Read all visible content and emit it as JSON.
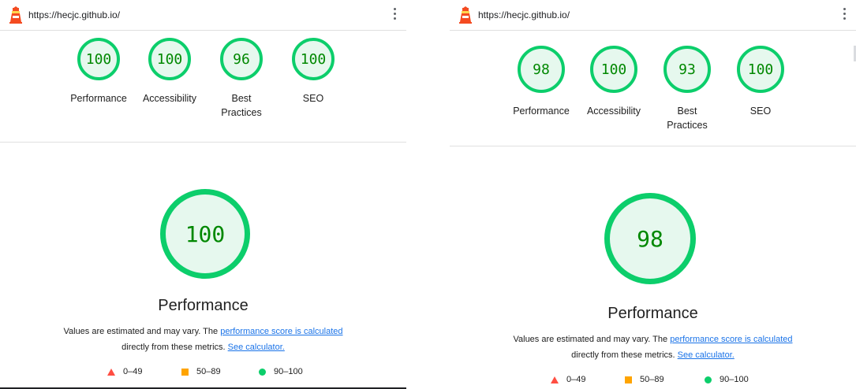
{
  "colors": {
    "pass": "#0cce6b",
    "pass_text": "#008800",
    "average": "#ffa400",
    "fail": "#ff4e42",
    "link": "#1a73e8"
  },
  "reports": [
    {
      "url": "https://hecjc.github.io/",
      "scores": [
        {
          "value": "100",
          "label": "Performance"
        },
        {
          "value": "100",
          "label": "Accessibility"
        },
        {
          "value": "96",
          "label": "Best Practices"
        },
        {
          "value": "100",
          "label": "SEO"
        }
      ],
      "main_score": "100",
      "main_title": "Performance",
      "desc_prefix": "Values are estimated and may vary. The ",
      "desc_link1": "performance score is calculated",
      "desc_middle": "directly from these metrics. ",
      "desc_link2": "See calculator.",
      "legend": [
        {
          "icon": "fail-triangle-icon",
          "range": "0–49"
        },
        {
          "icon": "average-square-icon",
          "range": "50–89"
        },
        {
          "icon": "pass-circle-icon",
          "range": "90–100"
        }
      ]
    },
    {
      "url": "https://hecjc.github.io/",
      "scores": [
        {
          "value": "98",
          "label": "Performance"
        },
        {
          "value": "100",
          "label": "Accessibility"
        },
        {
          "value": "93",
          "label": "Best Practices"
        },
        {
          "value": "100",
          "label": "SEO"
        }
      ],
      "main_score": "98",
      "main_title": "Performance",
      "desc_prefix": "Values are estimated and may vary. The ",
      "desc_link1": "performance score is calculated",
      "desc_middle": "directly from these metrics. ",
      "desc_link2": "See calculator.",
      "legend": [
        {
          "icon": "fail-triangle-icon",
          "range": "0–49"
        },
        {
          "icon": "average-square-icon",
          "range": "50–89"
        },
        {
          "icon": "pass-circle-icon",
          "range": "90–100"
        }
      ]
    }
  ]
}
